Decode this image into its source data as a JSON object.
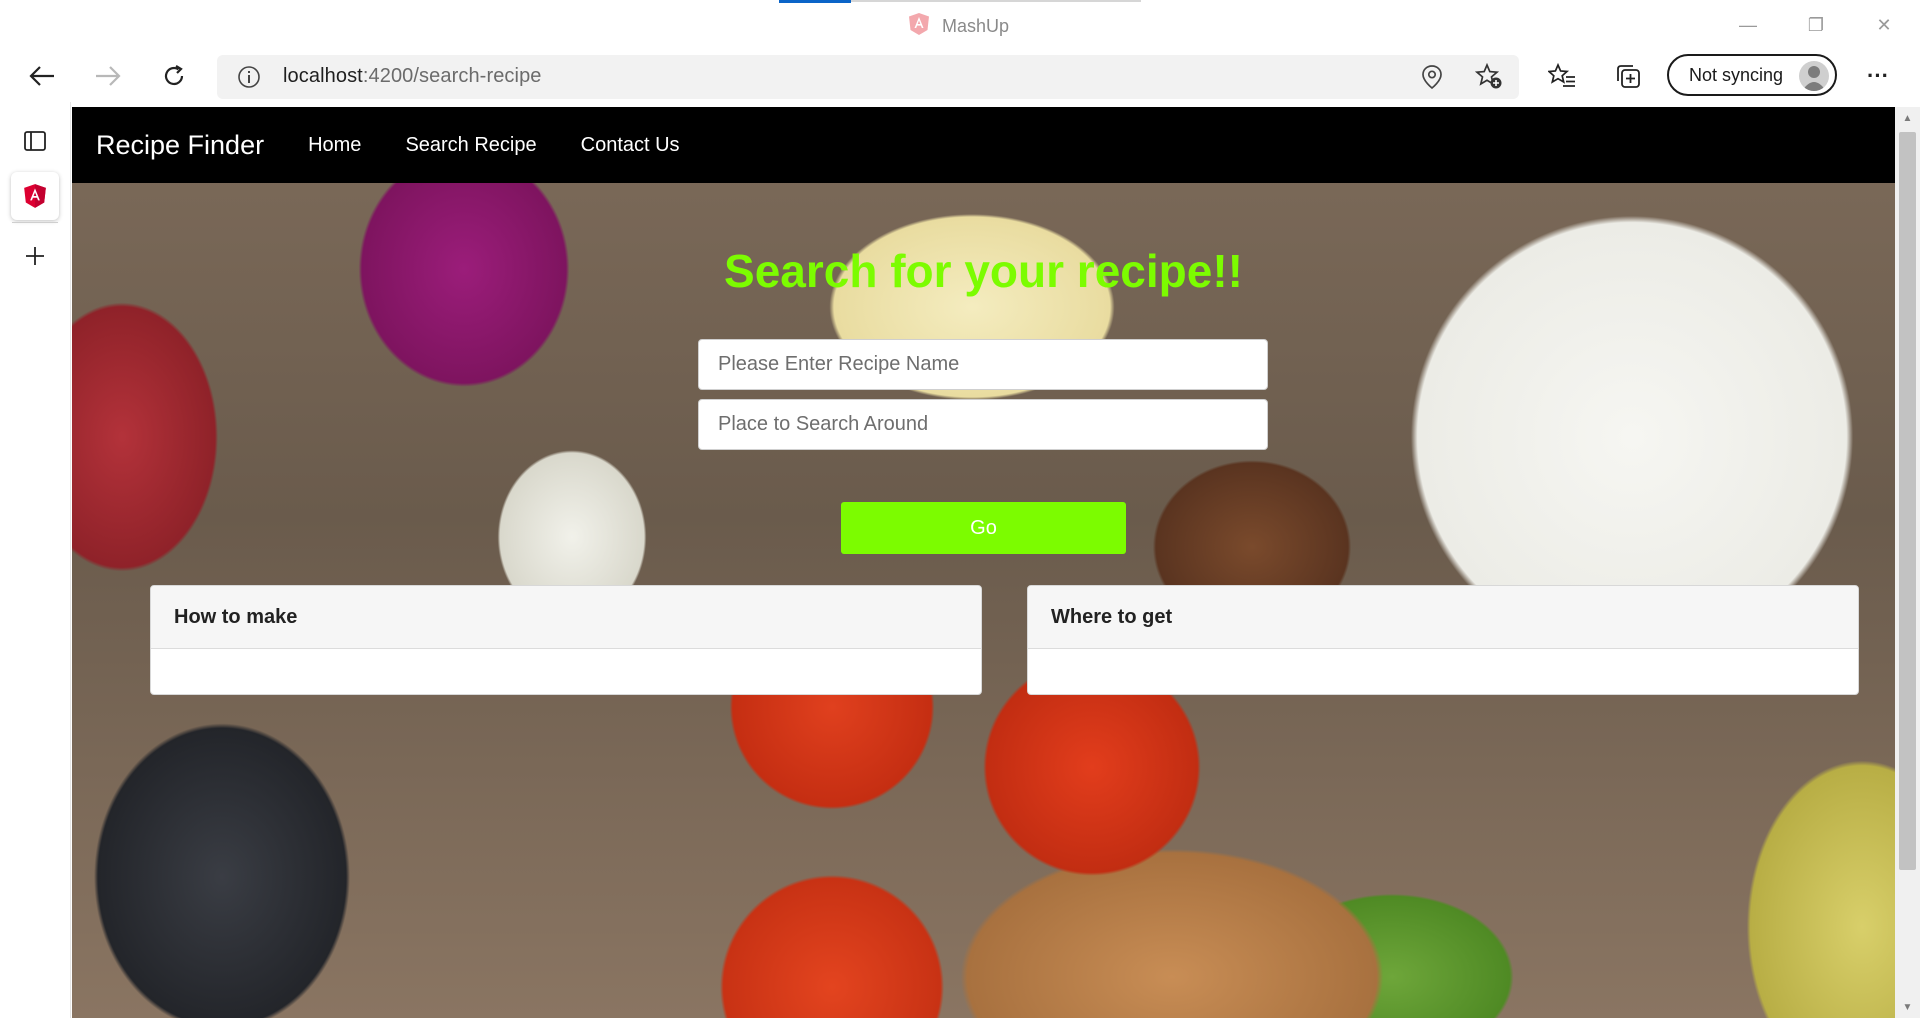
{
  "window": {
    "title": "MashUp",
    "controls": {
      "minimize": "—",
      "restore": "❐",
      "close": "✕"
    }
  },
  "toolbar": {
    "url_host": "localhost",
    "url_rest": ":4200/search-recipe",
    "sync_label": "Not syncing",
    "more_label": "···"
  },
  "page": {
    "brand": "Recipe Finder",
    "nav": [
      "Home",
      "Search Recipe",
      "Contact Us"
    ],
    "heading": "Search for your recipe!!",
    "recipe_placeholder": "Please Enter Recipe Name",
    "place_placeholder": "Place to Search Around",
    "go_label": "Go",
    "cards": [
      {
        "title": "How to make"
      },
      {
        "title": "Where to get"
      }
    ],
    "colors": {
      "accent": "#7cfc00",
      "navbar": "#000000"
    }
  },
  "scrollbar": {
    "up": "▲",
    "down": "▼"
  }
}
